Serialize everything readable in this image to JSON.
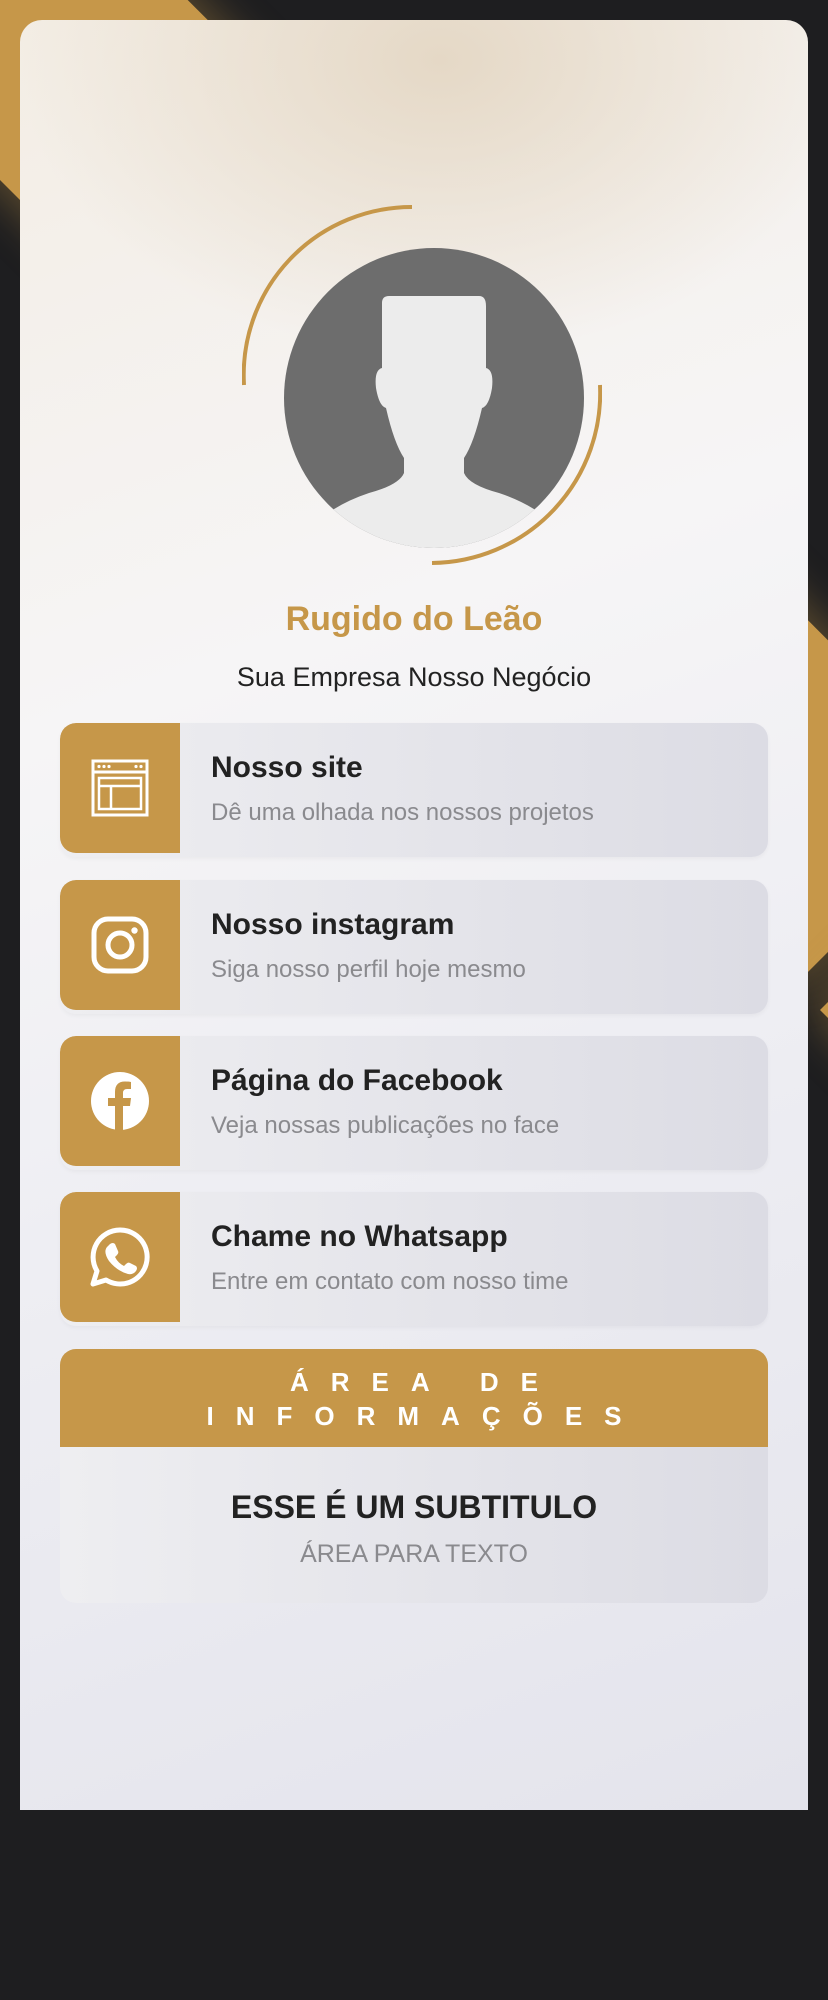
{
  "profile": {
    "name": "Rugido do Leão",
    "tagline": "Sua Empresa Nosso Negócio",
    "avatar_icon": "user-silhouette-icon"
  },
  "links": [
    {
      "title": "Nosso site",
      "subtitle": "Dê uma olhada nos nossos projetos",
      "icon": "browser-window-icon"
    },
    {
      "title": "Nosso instagram",
      "subtitle": "Siga nosso perfil hoje mesmo",
      "icon": "instagram-icon"
    },
    {
      "title": "Página do Facebook",
      "subtitle": "Veja nossas publicações no face",
      "icon": "facebook-icon"
    },
    {
      "title": "Chame no Whatsapp",
      "subtitle": "Entre em contato com nosso time",
      "icon": "whatsapp-icon"
    }
  ],
  "info": {
    "heading_line1": "ÁREA DE",
    "heading_line2": "INFORMAÇÕES",
    "subtitle": "ESSE É UM SUBTITULO",
    "text": "ÁREA PARA TEXTO"
  },
  "colors": {
    "accent": "#c69749",
    "background": "#1e1e20",
    "avatar": "#6d6d6d"
  }
}
